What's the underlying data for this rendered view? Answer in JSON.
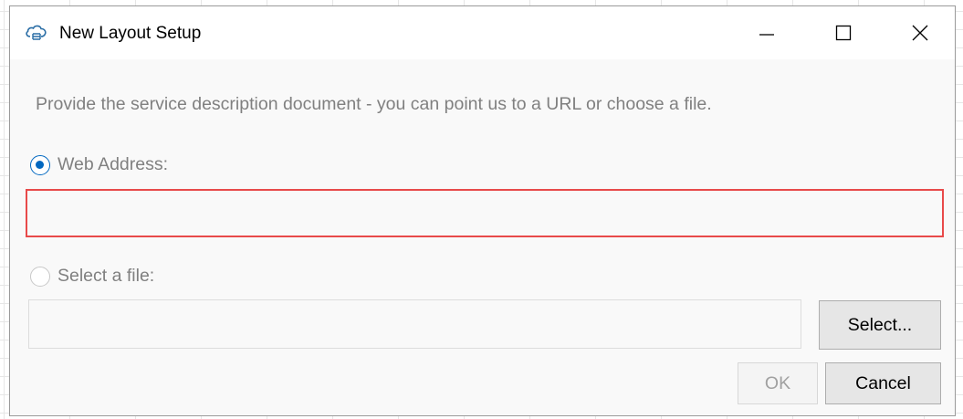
{
  "window": {
    "title": "New Layout Setup",
    "app_icon": "cloud-icon",
    "controls": {
      "minimize_icon": "minimize-icon",
      "maximize_icon": "maximize-icon",
      "close_icon": "close-icon"
    }
  },
  "dialog": {
    "instructions": "Provide the service description document - you can point us to a URL or choose a file.",
    "web_address": {
      "label": "Web Address:",
      "selected": true,
      "value": ""
    },
    "select_file": {
      "label": "Select a file:",
      "selected": false,
      "value": ""
    },
    "select_button": "Select...",
    "ok_button": "OK",
    "cancel_button": "Cancel"
  },
  "colors": {
    "accent": "#0067c0",
    "error_border": "#e84a4a",
    "disabled_text": "#a0a0a0",
    "muted_text": "#808080"
  }
}
